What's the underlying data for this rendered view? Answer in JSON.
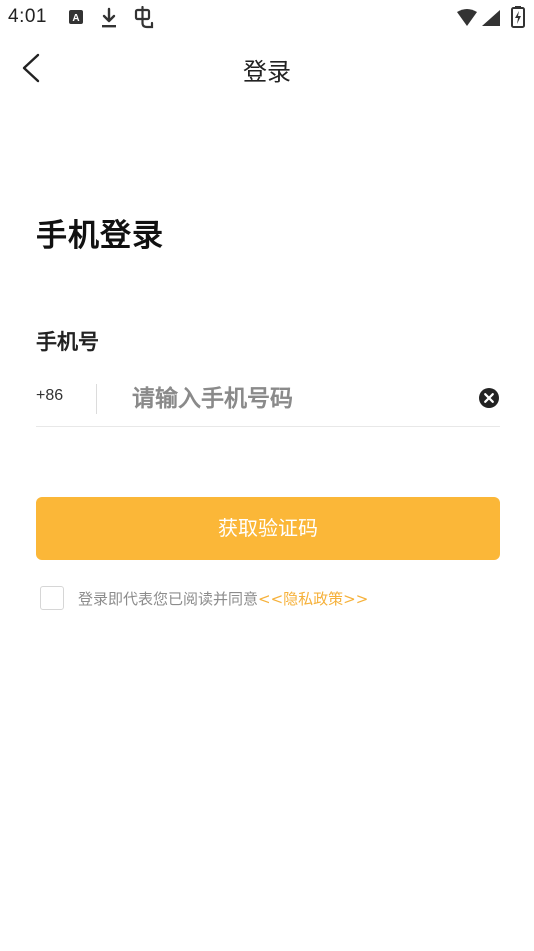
{
  "status_bar": {
    "time": "4:01",
    "left_icons": [
      "app-a-icon",
      "download-icon",
      "notification-icon"
    ],
    "right_icons": [
      "wifi-icon",
      "signal-icon",
      "battery-icon"
    ]
  },
  "header": {
    "back_icon": "chevron-left-icon",
    "title": "登录"
  },
  "login": {
    "heading": "手机登录",
    "phone_label": "手机号",
    "country_code": "+86",
    "phone_value": "",
    "phone_placeholder": "请输入手机号码",
    "clear_icon": "clear-icon",
    "submit_label": "获取验证码",
    "agreement_text": "登录即代表您已阅读并同意",
    "policy_link": "<<隐私政策>>",
    "agreement_checked": false
  },
  "colors": {
    "accent": "#fbb738",
    "link": "#f6b13a",
    "muted_text": "#8c8c8c",
    "divider": "#e8e8e8"
  }
}
